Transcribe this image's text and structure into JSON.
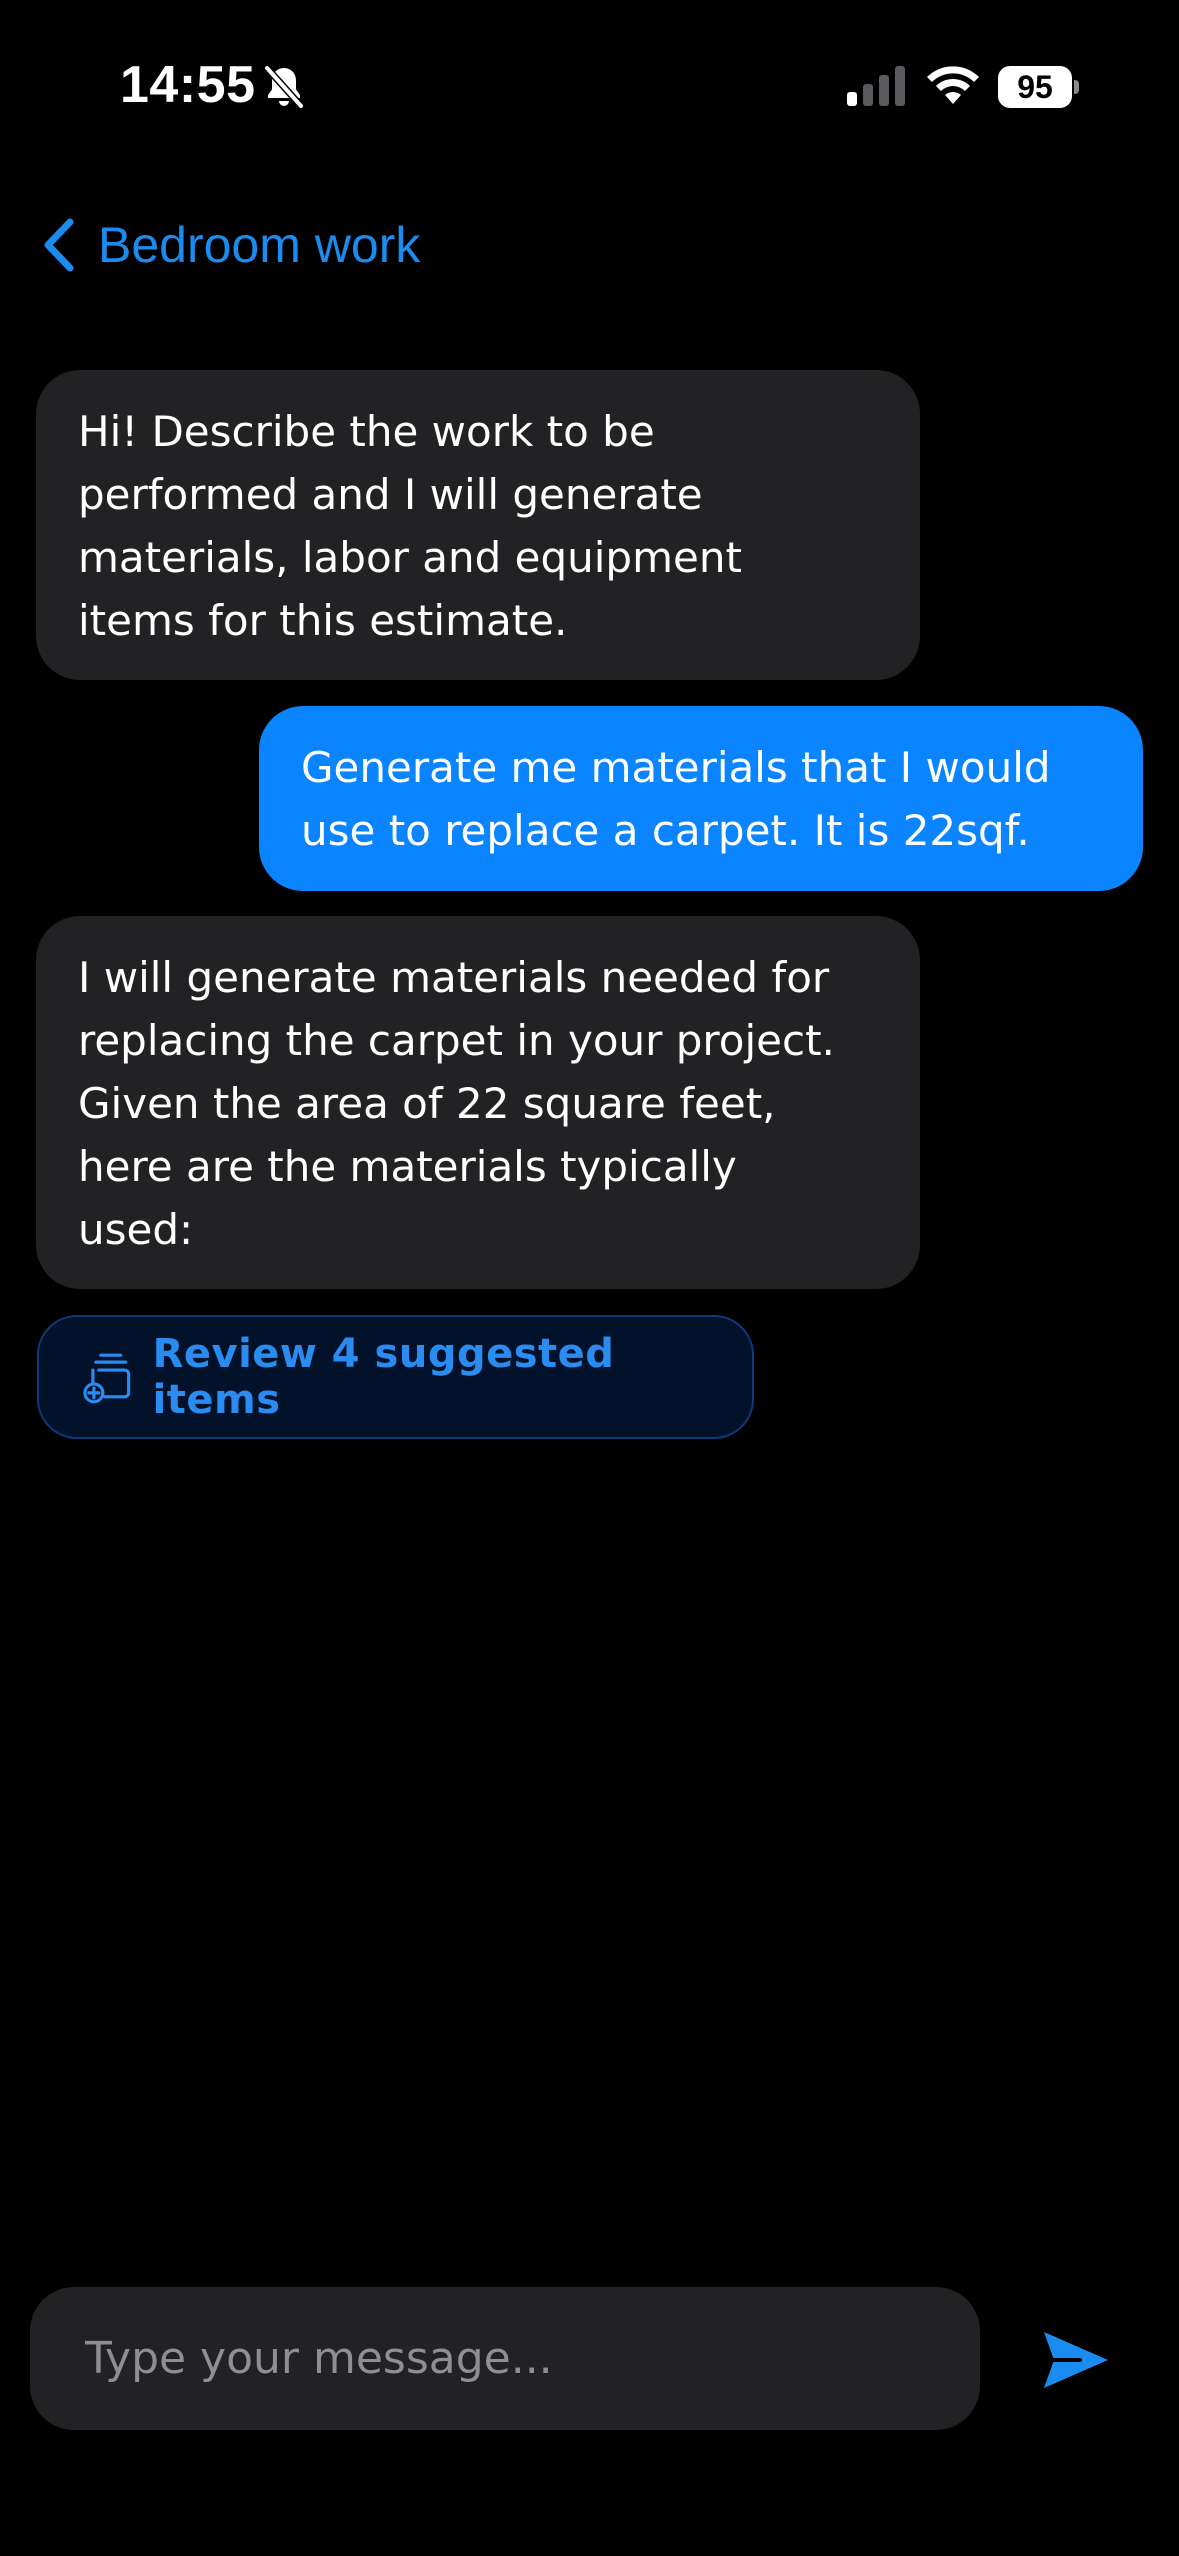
{
  "status_bar": {
    "time": "14:55",
    "battery_level": "95",
    "signal_bars_active": 1,
    "signal_bars_total": 4
  },
  "nav": {
    "back_label": "Bedroom work"
  },
  "messages": [
    {
      "role": "assistant",
      "text": "Hi! Describe the work to be\nperformed and I will generate\nmaterials, labor and equipment\nitems for this estimate."
    },
    {
      "role": "user",
      "text": "Generate me materials that I would\nuse to replace a carpet. It is 22sqf."
    },
    {
      "role": "assistant",
      "text": "I will generate materials needed for\nreplacing the carpet in your project.\nGiven the area of 22 square feet,\nhere are the materials typically\nused:"
    }
  ],
  "review_button": {
    "label": "Review 4 suggested items",
    "icon": "add-stack-icon"
  },
  "composer": {
    "placeholder": "Type your message...",
    "value": "",
    "send_icon": "send-icon"
  },
  "colors": {
    "background": "#000000",
    "accent": "#0a84ff",
    "bot_bubble": "#222224",
    "link": "#1a8cf0"
  }
}
